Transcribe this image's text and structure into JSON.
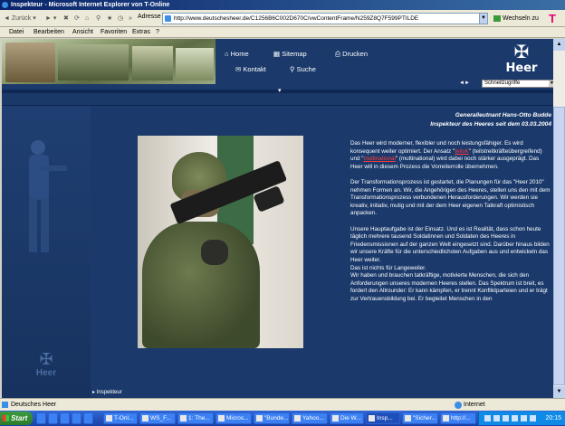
{
  "window": {
    "title": "Inspekteur - Microsoft Internet Explorer von T-Online"
  },
  "toolbar": {
    "back": "Zurück",
    "address_label": "Adresse",
    "address_value": "http://www.deutschesheer.de/C1256B6C002D670C/vwContentFrame/N259Z8Q7F599PTILDE",
    "go_label": "Wechseln zu",
    "brand": "T"
  },
  "menu": [
    "Datei",
    "Bearbeiten",
    "Ansicht",
    "Favoriten",
    "Extras",
    "?"
  ],
  "header_nav": {
    "home": "Home",
    "sitemap": "Sitemap",
    "drucken": "Drucken",
    "kontakt": "Kontakt",
    "suche": "Suche",
    "logo": "Heer",
    "quick_select": "Schnellzugriffe"
  },
  "article": {
    "heading_line1": "Generalleutnant Hans-Otto Budde",
    "heading_line2": "Inspekteur des Heeres seit dem 03.03.2004",
    "p1_a": "Das Heer wird moderner, flexibler und noch leistungsfähiger. Es wird konsequent weiter optimiert. Der Ansatz \"",
    "p1_link1": "teilsK",
    "p1_b": "\" (teilstreitkräfteübergreifend) und \"",
    "p1_link2": "multinational",
    "p1_c": "\" (multinational) wird dabei noch stärker ausgeprägt. Das Heer will in diesem Prozess die Vorreiterrolle übernehmen.",
    "p2": "Der Transformationsprozess ist gestartet, die Planungen für das \"Heer 2010\" nehmen Formen an. Wir, die Angehörigen des Heeres, stellen uns den mit dem Transformationsprozess verbundenen Herausforderungen. Wir werden sie kreativ, initiativ, mutig und mit der dem Heer eigenen Tatkraft optimistisch anpacken.",
    "p3": "Unsere Hauptaufgabe ist der Einsatz. Und es ist Realität, dass schon heute täglich mehrere tausend Soldatinnen und Soldaten des Heeres in Friedensmissionen auf der ganzen Welt eingesetzt sind. Darüber hinaus bilden wir unsere Kräfte für die unterschiedlichsten Aufgaben aus und entwickeln das Heer weiter.",
    "p4": "Das ist nichts für Langeweiler.",
    "p5": "Wir haben und brauchen tatkräftige, motivierte Menschen, die sich den Anforderungen unseres modernen Heeres stellen. Das Spektrum ist breit, es fordert den Allrounder: Er kann kämpfen, er trennt Konfliktparteien und er trägt zur Vertrauensbildung bei. Er begleitet Menschen in den"
  },
  "sidebar": {
    "logo": "Heer"
  },
  "footer_label": "Inspekteur",
  "status": {
    "left": "Deutsches Heer",
    "zone": "Internet"
  },
  "taskbar": {
    "start": "Start",
    "tasks": [
      "T-Onl...",
      "WS_F...",
      "1: The...",
      "Micros...",
      "\"Bunde...",
      "Yahoo...",
      "Die W...",
      "Insp...",
      "\"Sicher...",
      "http://..."
    ],
    "time": "20:15"
  }
}
